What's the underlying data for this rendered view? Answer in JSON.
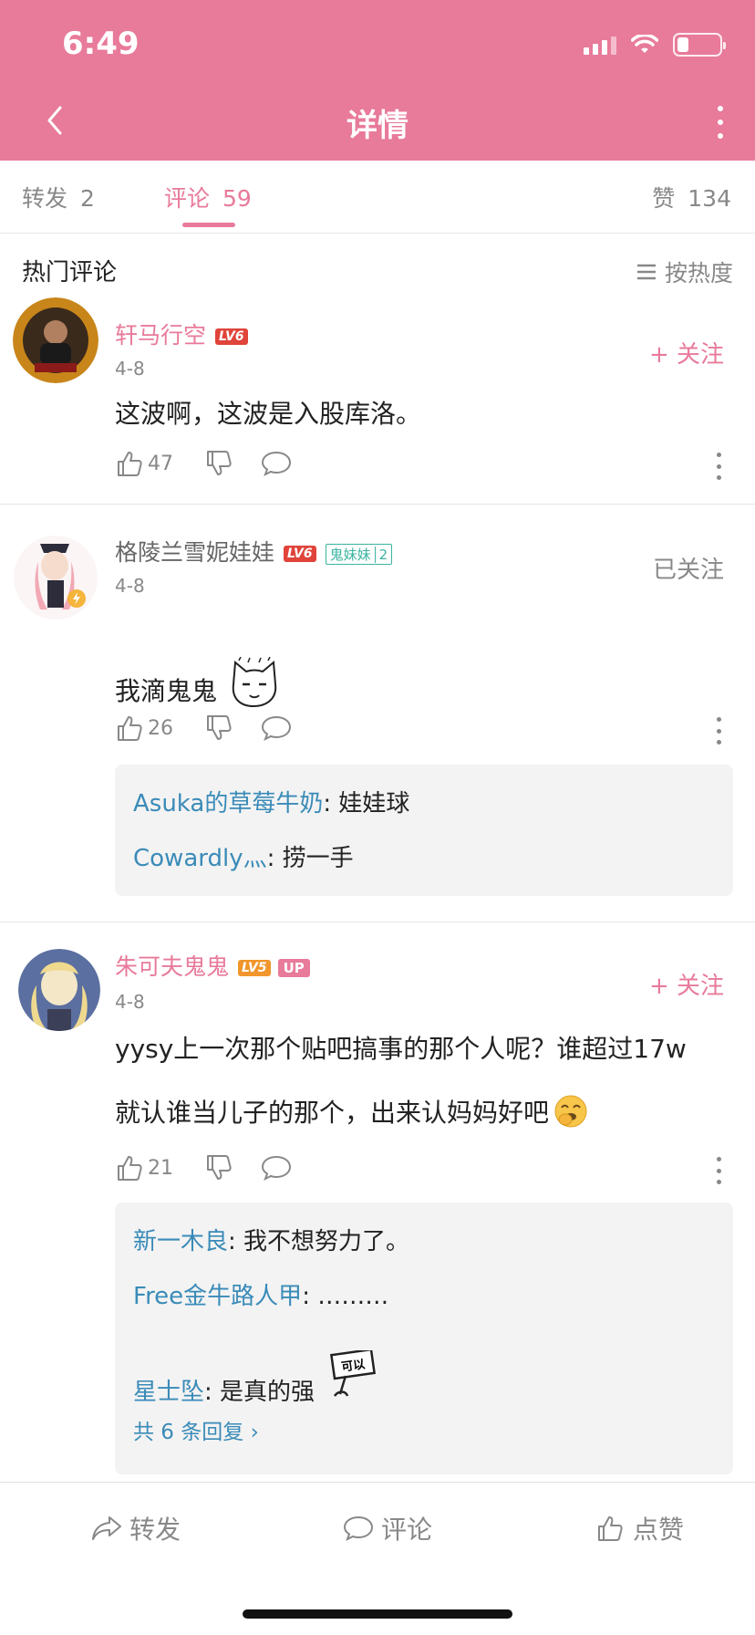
{
  "status": {
    "time": "6:49"
  },
  "header": {
    "title": "详情"
  },
  "tabs": [
    {
      "label": "转发",
      "count": "2"
    },
    {
      "label": "评论",
      "count": "59"
    },
    {
      "label": "赞",
      "count": "134"
    }
  ],
  "section": {
    "title": "热门评论",
    "sort_label": "按热度"
  },
  "comments": [
    {
      "user": "轩马行空",
      "level": "LV6",
      "date": "4-8",
      "follow": "+ 关注",
      "text": "这波啊，这波是入股库洛。",
      "likes": "47"
    },
    {
      "user": "格陵兰雪妮娃娃",
      "level": "LV6",
      "fan_badge": "鬼妹妹",
      "fan_level": "2",
      "date": "4-8",
      "follow": "已关注",
      "text": "我滴鬼鬼",
      "likes": "26",
      "replies": [
        {
          "user": "Asuka的草莓牛奶",
          "text": ": 娃娃球"
        },
        {
          "user": "Cowardly灬",
          "text": ": 捞一手"
        }
      ]
    },
    {
      "user": "朱可夫鬼鬼",
      "level": "LV5",
      "up_badge": "UP",
      "date": "4-8",
      "follow": "+ 关注",
      "text_line1": "yysy上一次那个贴吧搞事的那个人呢？谁超过17w",
      "text_line2": "就认谁当儿子的那个，出来认妈妈好吧",
      "likes": "21",
      "replies": [
        {
          "user": "新一木良",
          "text": ": 我不想努力了。"
        },
        {
          "user": "Free金牛路人甲",
          "text": ": ………"
        },
        {
          "user": "星士坠",
          "text": ": 是真的强"
        }
      ],
      "more_replies": "共 6 条回复 ›",
      "sticker_text": "可以"
    }
  ],
  "bottom_bar": {
    "repost": "转发",
    "comment": "评论",
    "like": "点赞"
  },
  "colors": {
    "accent": "#E87A9A",
    "link": "#3a8bb8",
    "lv6": "#e0443a",
    "lv5": "#f0962c"
  }
}
